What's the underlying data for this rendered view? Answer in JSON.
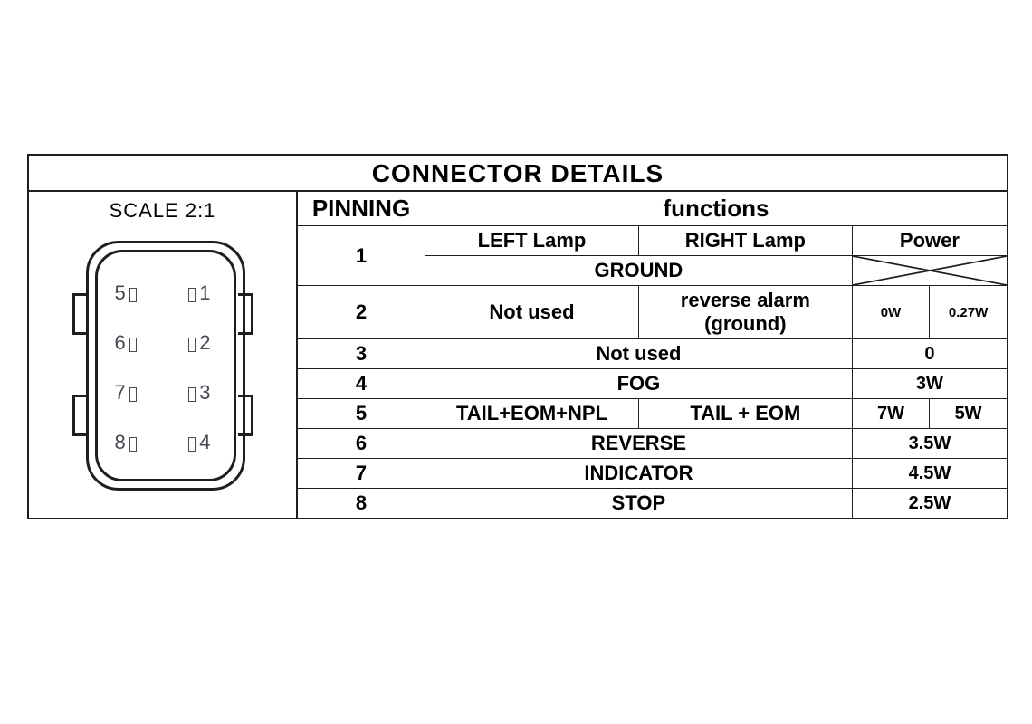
{
  "title": "CONNECTOR DETAILS",
  "scale_label": "SCALE 2:1",
  "connector_pins": {
    "left_column": [
      "5",
      "6",
      "7",
      "8"
    ],
    "right_column": [
      "1",
      "2",
      "3",
      "4"
    ]
  },
  "headers": {
    "pinning": "PINNING",
    "functions": "functions",
    "left_lamp": "LEFT Lamp",
    "right_lamp": "RIGHT Lamp",
    "power": "Power"
  },
  "rows": {
    "r1": {
      "pin": "1",
      "func_merged": "GROUND"
    },
    "r2": {
      "pin": "2",
      "left": "Not used",
      "right": "reverse alarm\n(ground)",
      "power_left": "0W",
      "power_right": "0.27W"
    },
    "r3": {
      "pin": "3",
      "func_merged": "Not used",
      "power_merged": "0"
    },
    "r4": {
      "pin": "4",
      "func_merged": "FOG",
      "power_merged": "3W"
    },
    "r5": {
      "pin": "5",
      "left": "TAIL+EOM+NPL",
      "right": "TAIL + EOM",
      "power_left": "7W",
      "power_right": "5W"
    },
    "r6": {
      "pin": "6",
      "func_merged": "REVERSE",
      "power_merged": "3.5W"
    },
    "r7": {
      "pin": "7",
      "func_merged": "INDICATOR",
      "power_merged": "4.5W"
    },
    "r8": {
      "pin": "8",
      "func_merged": "STOP",
      "power_merged": "2.5W"
    }
  }
}
